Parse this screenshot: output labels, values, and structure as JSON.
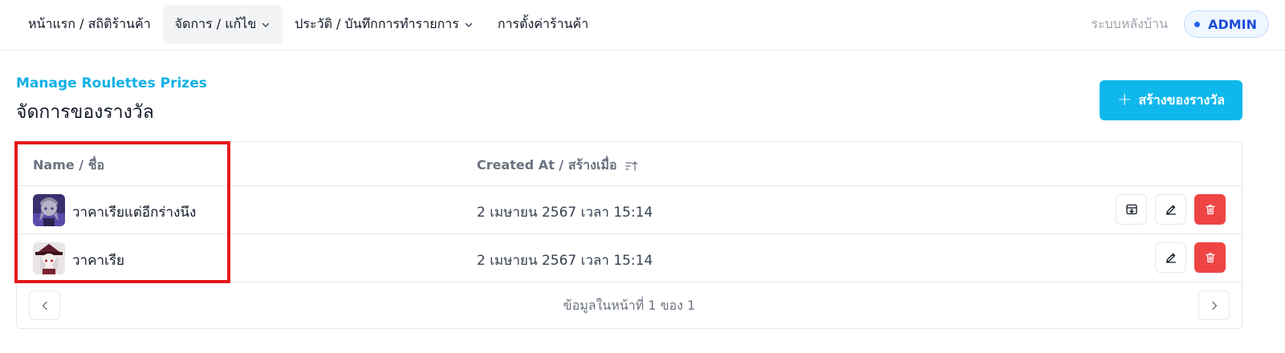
{
  "nav": {
    "items": [
      {
        "label": "หน้าแรก / สถิติร้านค้า",
        "has_dropdown": false,
        "active": false
      },
      {
        "label": "จัดการ / แก้ไข",
        "has_dropdown": true,
        "active": true
      },
      {
        "label": "ประวัติ / บันทึกการทำรายการ",
        "has_dropdown": true,
        "active": false
      },
      {
        "label": "การตั้งค่าร้านค้า",
        "has_dropdown": false,
        "active": false
      }
    ],
    "backend_label": "ระบบหลังบ้าน",
    "role_badge": "ADMIN"
  },
  "header": {
    "subtitle": "Manage Roulettes Prizes",
    "title": "จัดการของรางวัล",
    "create_button": "สร้างของรางวัล"
  },
  "table": {
    "columns": {
      "name": "Name / ชื่อ",
      "created_at": "Created At / สร้างเมื่อ"
    },
    "rows": [
      {
        "name": "วาคาเรียแต่อีกร่างนึง",
        "created_at": "2 เมษายน 2567 เวลา 15:14",
        "actions": [
          "archive",
          "edit",
          "delete"
        ]
      },
      {
        "name": "วาคาเรีย",
        "created_at": "2 เมษายน 2567 เวลา 15:14",
        "actions": [
          "edit",
          "delete"
        ]
      }
    ],
    "pagination": "ข้อมูลในหน้าที่ 1 ของ 1"
  },
  "colors": {
    "accent": "#0fb8ec",
    "subtitle": "#0fb0e6",
    "danger": "#ef4444",
    "admin": "#1d4ed8",
    "highlight": "#e3191b"
  },
  "icons": {
    "create": "plus-icon",
    "sort": "sort-ascending-icon",
    "archive": "archive-download-icon",
    "edit": "pencil-icon",
    "delete": "trash-icon",
    "prev": "chevron-left-icon",
    "next": "chevron-right-icon"
  }
}
